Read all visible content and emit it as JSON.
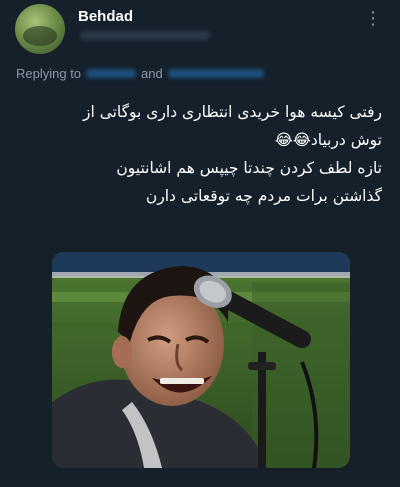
{
  "tweet": {
    "author_name": "Behdad",
    "menu_icon": "more-vertical-icon",
    "reply": {
      "prefix": "Replying to",
      "joiner": "and"
    },
    "lines": [
      "رفتی کیسه هوا خریدی انتظاری داری بوگاتی از",
      "توش دربیاد😂😂",
      "تازه لطف کردن چندتا چیپس هم اشانتیون",
      "گذاشتن برات مردم چه توقعاتی دارن"
    ],
    "media": {
      "icon": "laughing-man-with-microphone-image"
    }
  },
  "colors": {
    "background": "#15202b",
    "text": "#ffffff",
    "secondary_text": "#8b98a5",
    "link_blue": "#1d9bf0"
  }
}
